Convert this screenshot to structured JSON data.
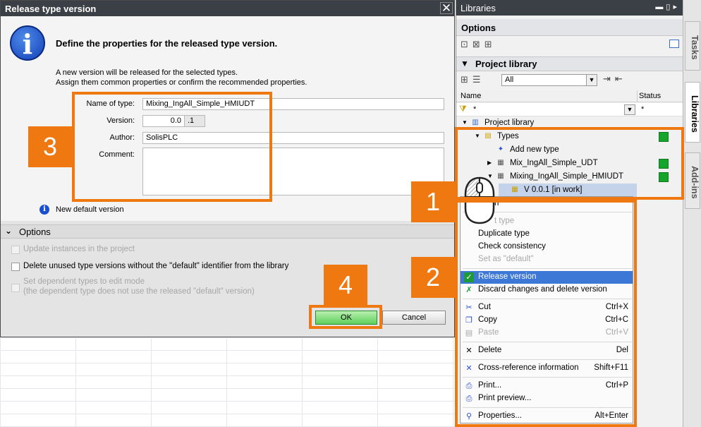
{
  "dialog": {
    "title": "Release type version",
    "close_glyph": "✕",
    "heading": "Define the properties for the released type version.",
    "intro_line1": "A new version will be released for the selected types.",
    "intro_line2": "Assign them common properties or confirm the recommended properties.",
    "fields": {
      "name_label": "Name of type:",
      "name_value": "Mixing_IngAll_Simple_HMIUDT",
      "version_label": "Version:",
      "version_major": "0.0",
      "version_minor": ".1",
      "author_label": "Author:",
      "author_value": "SolisPLC",
      "comment_label": "Comment:",
      "comment_value": ""
    },
    "new_default_text": "New default version",
    "options_label": "Options",
    "options": [
      {
        "label": "Update instances in the project",
        "checked": false,
        "enabled": false
      },
      {
        "label": "Delete unused type versions without the \"default\" identifier from the library",
        "checked": false,
        "enabled": true
      },
      {
        "label": "Set dependent types to edit mode",
        "label2": "(the dependent type does not use the released \"default\" version)",
        "checked": false,
        "enabled": false
      }
    ],
    "ok_label": "OK",
    "cancel_label": "Cancel"
  },
  "annotations": {
    "n1": "1",
    "n2": "2",
    "n3": "3",
    "n4": "4",
    "color": "#f07810"
  },
  "libraries": {
    "title": "Libraries",
    "options_label": "Options",
    "project_library_label": "Project library",
    "filter_value": "All",
    "col_name": "Name",
    "col_status": "Status",
    "filter_name": "*",
    "filter_status": "*",
    "tree": [
      {
        "label": "Project library",
        "icon": "library-icon"
      },
      {
        "label": "Types",
        "icon": "folder-icon",
        "status": "green"
      },
      {
        "label": "Add new type",
        "icon": "add-type-icon"
      },
      {
        "label": "Mix_IngAll_Simple_UDT",
        "icon": "udt-icon",
        "status": "green"
      },
      {
        "label": "Mixing_IngAll_Simple_HMIUDT",
        "icon": "udt-icon",
        "status": "green"
      },
      {
        "label": "V 0.0.1 [in work]",
        "icon": "version-icon"
      }
    ],
    "status_color": "#15a52a"
  },
  "context_menu": {
    "items": [
      {
        "label": "n",
        "disabled": false
      },
      {
        "label": "t type",
        "disabled": true
      },
      {
        "label": "Duplicate type",
        "disabled": false
      },
      {
        "label": "Check consistency",
        "disabled": false
      },
      {
        "label": "Set as \"default\"",
        "disabled": true
      },
      {
        "label": "Release version",
        "highlighted": true,
        "icon": "release-icon"
      },
      {
        "label": "Discard changes and delete version",
        "icon": "discard-icon"
      },
      {
        "label": "Cut",
        "shortcut": "Ctrl+X",
        "icon": "scissors-icon"
      },
      {
        "label": "Copy",
        "shortcut": "Ctrl+C",
        "icon": "copy-icon"
      },
      {
        "label": "Paste",
        "shortcut": "Ctrl+V",
        "disabled": true,
        "icon": "paste-icon"
      },
      {
        "label": "Delete",
        "shortcut": "Del",
        "icon": "delete-icon"
      },
      {
        "label": "Cross-reference information",
        "shortcut": "Shift+F11",
        "icon": "cross-reference-icon"
      },
      {
        "label": "Print...",
        "shortcut": "Ctrl+P",
        "icon": "print-icon"
      },
      {
        "label": "Print preview...",
        "icon": "print-preview-icon"
      },
      {
        "label": "Properties...",
        "shortcut": "Alt+Enter",
        "icon": "properties-icon"
      }
    ]
  },
  "side_tabs": {
    "tasks": "Tasks",
    "libraries": "Libraries",
    "addins": "Add-ins"
  }
}
